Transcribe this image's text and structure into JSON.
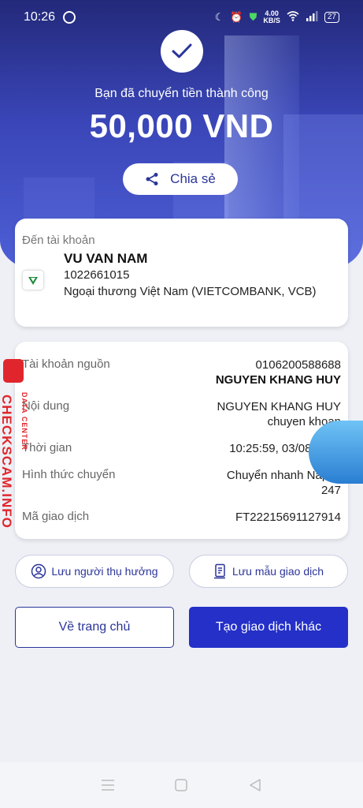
{
  "status_bar": {
    "time": "10:26",
    "speed_top": "4.00",
    "speed_bottom": "KB/S",
    "battery": "27"
  },
  "hero": {
    "success_text": "Bạn đã chuyển tiền thành công",
    "amount": "50,000 VND",
    "share_label": "Chia sẻ"
  },
  "recipient": {
    "label": "Đến tài khoản",
    "name": "VU VAN NAM",
    "account": "1022661015",
    "bank": "Ngoại thương Việt Nam (VIETCOMBANK, VCB)"
  },
  "details": {
    "source_label": "Tài khoản nguồn",
    "source_account": "0106200588688",
    "source_name": "NGUYEN KHANG HUY",
    "content_label": "Nội dung",
    "content_line1": "NGUYEN KHANG HUY",
    "content_line2": "chuyen khoan",
    "time_label": "Thời gian",
    "time_value": "10:25:59, 03/08/2022",
    "method_label": "Hình thức chuyển",
    "method_line1": "Chuyển nhanh Napas",
    "method_line2": "247",
    "code_label": "Mã giao dịch",
    "code_value": "FT22215691127914"
  },
  "actions": {
    "save_beneficiary": "Lưu người thụ hưởng",
    "save_template": "Lưu mẫu giao dịch",
    "home": "Về trang chủ",
    "new_transaction": "Tạo giao dịch khác"
  },
  "watermark": {
    "main": "CHECKSCAM.INFO",
    "sub": "DATA CENTER"
  },
  "colors": {
    "primary": "#2430c8",
    "brand_dark": "#2b3599",
    "watermark": "#e0262c"
  }
}
